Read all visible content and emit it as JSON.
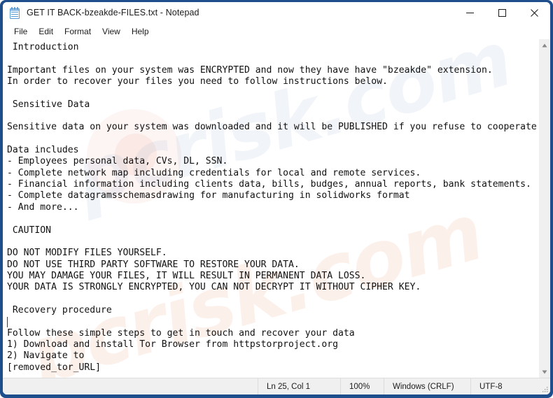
{
  "window": {
    "title": "GET IT BACK-bzeakde-FILES.txt - Notepad",
    "app_icon": "notepad-icon",
    "border_color": "#1f4e8c",
    "controls": [
      {
        "name": "minimize",
        "glyph": "minimize-icon"
      },
      {
        "name": "maximize",
        "glyph": "maximize-icon"
      },
      {
        "name": "close",
        "glyph": "close-icon"
      }
    ]
  },
  "menubar": {
    "items": [
      {
        "label": "File"
      },
      {
        "label": "Edit"
      },
      {
        "label": "Format"
      },
      {
        "label": "View"
      },
      {
        "label": "Help"
      }
    ]
  },
  "document": {
    "lines": [
      " Introduction",
      "",
      "Important files on your system was ENCRYPTED and now they have have \"bzeakde\" extension.",
      "In order to recover your files you need to follow instructions below.",
      "",
      " Sensitive Data",
      "",
      "Sensitive data on your system was downloaded and it will be PUBLISHED if you refuse to cooperate.",
      "",
      "Data includes",
      "- Employees personal data, CVs, DL, SSN.",
      "- Complete network map including credentials for local and remote services.",
      "- Financial information including clients data, bills, budges, annual reports, bank statements.",
      "- Complete datagramsschemasdrawing for manufacturing in solidworks format",
      "- And more...",
      "",
      " CAUTION",
      "",
      "DO NOT MODIFY FILES YOURSELF.",
      "DO NOT USE THIRD PARTY SOFTWARE TO RESTORE YOUR DATA.",
      "YOU MAY DAMAGE YOUR FILES, IT WILL RESULT IN PERMANENT DATA LOSS.",
      "YOUR DATA IS STRONGLY ENCRYPTED, YOU CAN NOT DECRYPT IT WITHOUT CIPHER KEY.",
      "",
      " Recovery procedure",
      "",
      "Follow these simple steps to get in touch and recover your data",
      "1) Download and install Tor Browser from httpstorproject.org",
      "2) Navigate to",
      "[removed_tor_URL]"
    ],
    "caret_line_index": 24,
    "watermark": "pcrisk.com"
  },
  "scrollbar": {
    "up_arrow": "scroll-up-icon",
    "down_arrow": "scroll-down-icon"
  },
  "statusbar": {
    "position": "Ln 25, Col 1",
    "zoom": "100%",
    "line_ending": "Windows (CRLF)",
    "encoding": "UTF-8"
  }
}
